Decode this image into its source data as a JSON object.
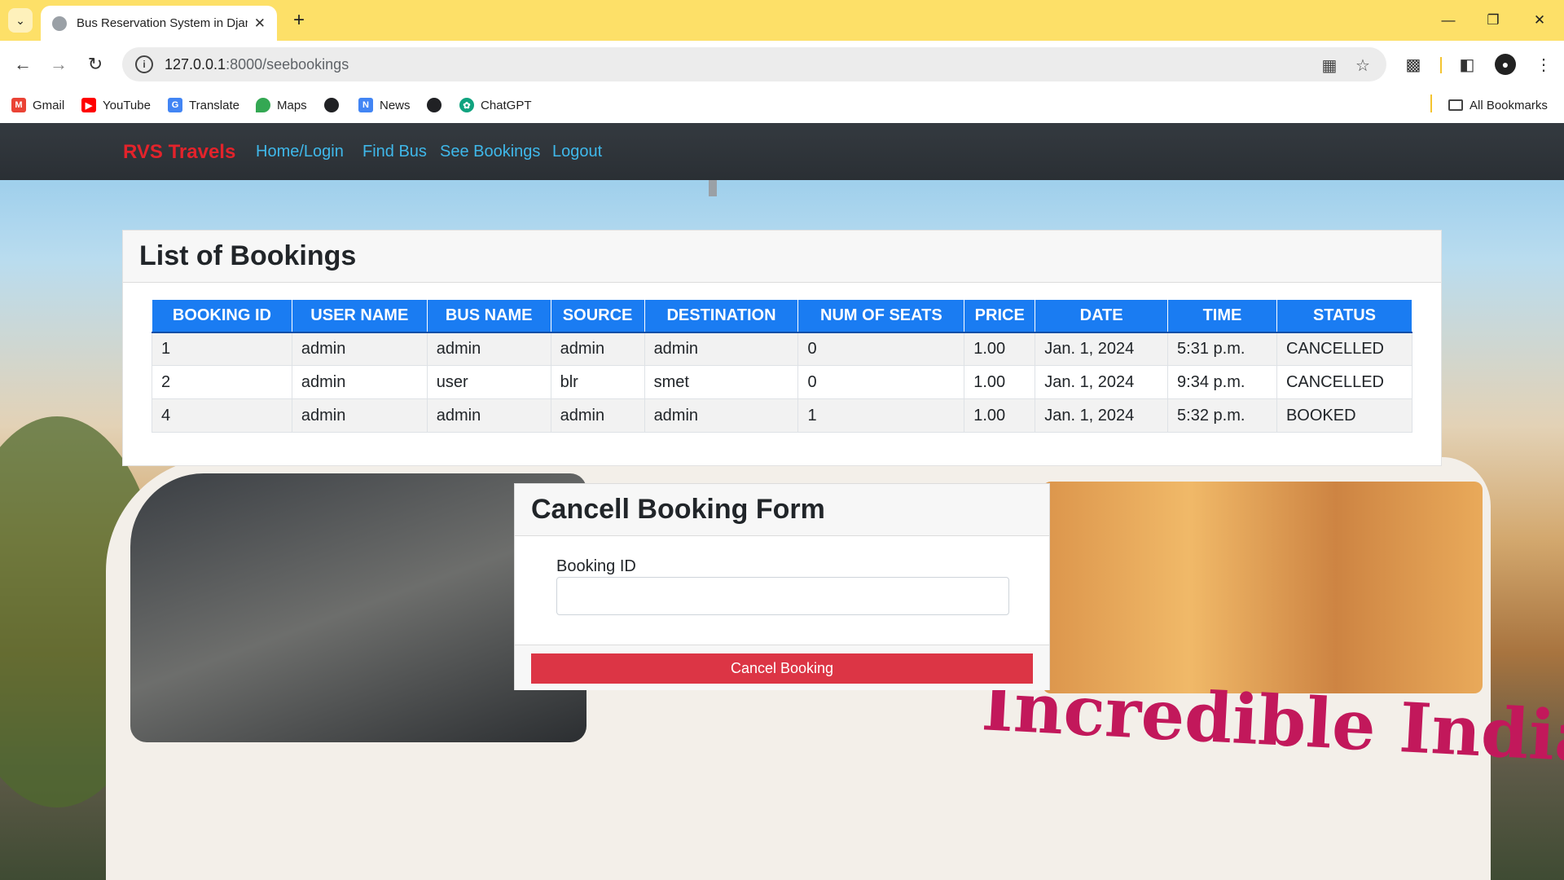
{
  "browser": {
    "tab_title": "Bus Reservation System in Djan",
    "url_host": "127.0.0.1",
    "url_path": ":8000/seebookings",
    "bookmarks": [
      {
        "label": "Gmail",
        "icon": "gmail-icon",
        "color": "#ea4335"
      },
      {
        "label": "YouTube",
        "icon": "youtube-icon",
        "color": "#ff0000"
      },
      {
        "label": "Translate",
        "icon": "translate-icon",
        "color": "#4285f4"
      },
      {
        "label": "Maps",
        "icon": "maps-icon",
        "color": "#34a853"
      },
      {
        "label": "",
        "icon": "globe-icon",
        "color": "#202124"
      },
      {
        "label": "News",
        "icon": "news-icon",
        "color": "#4285f4"
      },
      {
        "label": "",
        "icon": "globe-icon",
        "color": "#202124"
      },
      {
        "label": "ChatGPT",
        "icon": "chatgpt-icon",
        "color": "#10a37f"
      }
    ],
    "all_bookmarks": "All Bookmarks"
  },
  "navbar": {
    "brand": "RVS Travels",
    "links": [
      "Home/Login",
      "Find Bus",
      "See Bookings",
      "Logout"
    ],
    "brand_color": "#e3232b",
    "link_color": "#3fb8ea"
  },
  "bookings": {
    "title": "List of Bookings",
    "columns": [
      "BOOKING ID",
      "USER NAME",
      "BUS NAME",
      "SOURCE",
      "DESTINATION",
      "NUM OF SEATS",
      "PRICE",
      "DATE",
      "TIME",
      "STATUS"
    ],
    "rows": [
      [
        "1",
        "admin",
        "admin",
        "admin",
        "admin",
        "0",
        "1.00",
        "Jan. 1, 2024",
        "5:31 p.m.",
        "CANCELLED"
      ],
      [
        "2",
        "admin",
        "user",
        "blr",
        "smet",
        "0",
        "1.00",
        "Jan. 1, 2024",
        "9:34 p.m.",
        "CANCELLED"
      ],
      [
        "4",
        "admin",
        "admin",
        "admin",
        "admin",
        "1",
        "1.00",
        "Jan. 1, 2024",
        "5:32 p.m.",
        "BOOKED"
      ]
    ],
    "header_color": "#1a7cf2"
  },
  "cancel_form": {
    "title": "Cancell Booking Form",
    "label": "Booking ID",
    "value": "",
    "button": "Cancel Booking",
    "button_color": "#dc3545"
  },
  "background": {
    "bus_text": "Incredible India"
  }
}
